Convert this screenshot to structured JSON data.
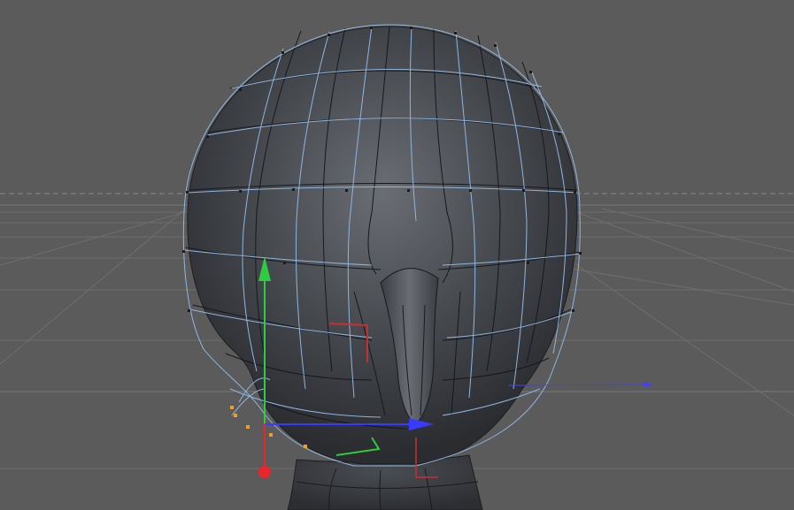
{
  "viewport": {
    "background_color": "#5b5b5b",
    "floor_grid_color": "#6e6e6e",
    "cage_color": "#8fb6e0",
    "mesh_fill_color": "#3b3e43",
    "horizon_style": "dashed"
  },
  "gizmo": {
    "x_axis_color": "#3a3aff",
    "y_axis_color": "#2ecc40",
    "z_axis_color": "#e8262c",
    "selected_points_color": "#f0a020"
  },
  "icons": {
    "x_axis_handle": "cone-arrow-icon",
    "y_axis_handle": "cone-arrow-icon",
    "z_axis_handle": "sphere-handle-icon",
    "plane_handle": "corner-bracket-icon"
  }
}
